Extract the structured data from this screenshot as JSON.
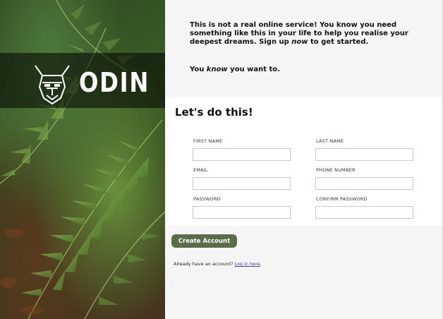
{
  "brand": {
    "name": "ODIN",
    "logo_icon": "viking-helmet-icon"
  },
  "intro": {
    "line1_a": "This is not a real online service! You know you need something like this in your life to help you realise your deepest dreams. Sign up ",
    "line1_em": "now",
    "line1_b": " to get started.",
    "line2_a": "You ",
    "line2_em": "know",
    "line2_b": " you want to."
  },
  "form": {
    "title": "Let's do this!",
    "fields": {
      "first_name": "FIRST NAME",
      "last_name": "LAST NAME",
      "email": "EMAIL",
      "phone": "PHONE NUMBER",
      "password": "PASSWORD",
      "confirm_password": "CONFIRM PASSWORD"
    },
    "submit_label": "Create Account",
    "login_prompt": "Already have an account? ",
    "login_link": "Log in here",
    "login_suffix": "."
  },
  "colors": {
    "button": "#596d48",
    "link": "#4b3aa0",
    "panel_bg": "#f5f5f5"
  }
}
